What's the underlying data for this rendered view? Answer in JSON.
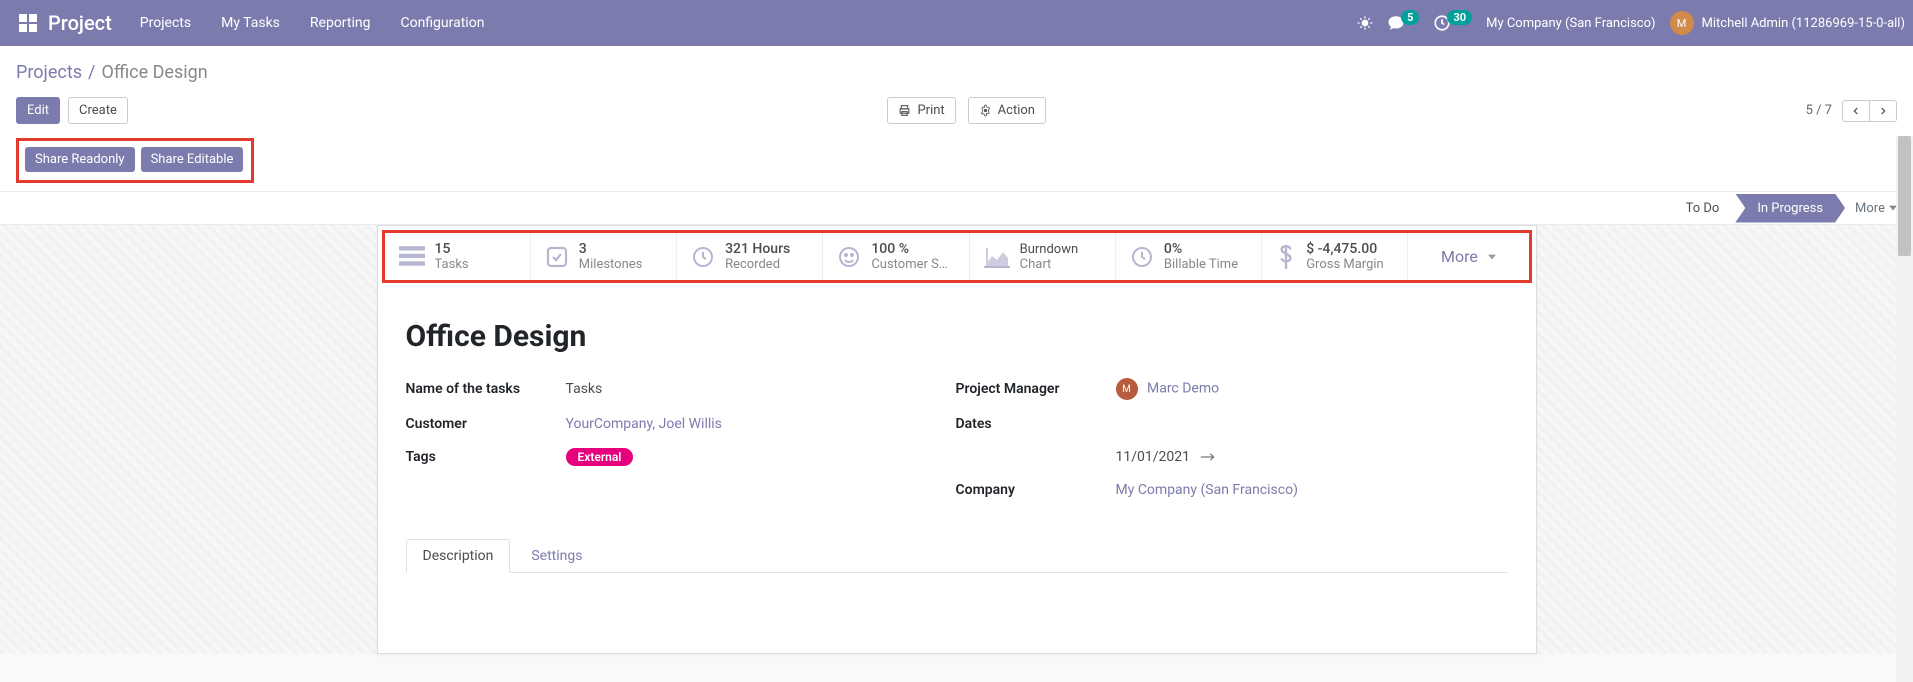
{
  "topbar": {
    "brand": "Project",
    "nav": [
      "Projects",
      "My Tasks",
      "Reporting",
      "Configuration"
    ],
    "chat_count": "5",
    "activity_count": "30",
    "company": "My Company (San Francisco)",
    "user": "Mitchell Admin (11286969-15-0-all)"
  },
  "breadcrumb": {
    "root": "Projects",
    "sep": "/",
    "current": "Office Design"
  },
  "buttons": {
    "edit": "Edit",
    "create": "Create",
    "print": "Print",
    "action": "Action"
  },
  "pager": "5 / 7",
  "share": {
    "readonly": "Share Readonly",
    "editable": "Share Editable"
  },
  "status": {
    "todo": "To Do",
    "inprogress": "In Progress",
    "more": "More"
  },
  "stats": [
    {
      "value": "15",
      "label": "Tasks"
    },
    {
      "value": "3",
      "label": "Milestones"
    },
    {
      "value": "321 Hours",
      "label": "Recorded"
    },
    {
      "value": "100 %",
      "label": "Customer S…"
    },
    {
      "value": "",
      "label": "Burndown",
      "label2": "Chart"
    },
    {
      "value": "0%",
      "label": "Billable Time"
    },
    {
      "value": "$ -4,475.00",
      "label": "Gross Margin"
    }
  ],
  "stats_more": "More",
  "title": "Office Design",
  "fields": {
    "tasks_name_label": "Name of the tasks",
    "tasks_name_value": "Tasks",
    "customer_label": "Customer",
    "customer_value": "YourCompany, Joel Willis",
    "tags_label": "Tags",
    "tags_value": "External",
    "pm_label": "Project Manager",
    "pm_value": "Marc Demo",
    "dates_label": "Dates",
    "date_start": "11/01/2021",
    "company_label": "Company",
    "company_value": "My Company (San Francisco)"
  },
  "tabs": {
    "description": "Description",
    "settings": "Settings"
  }
}
